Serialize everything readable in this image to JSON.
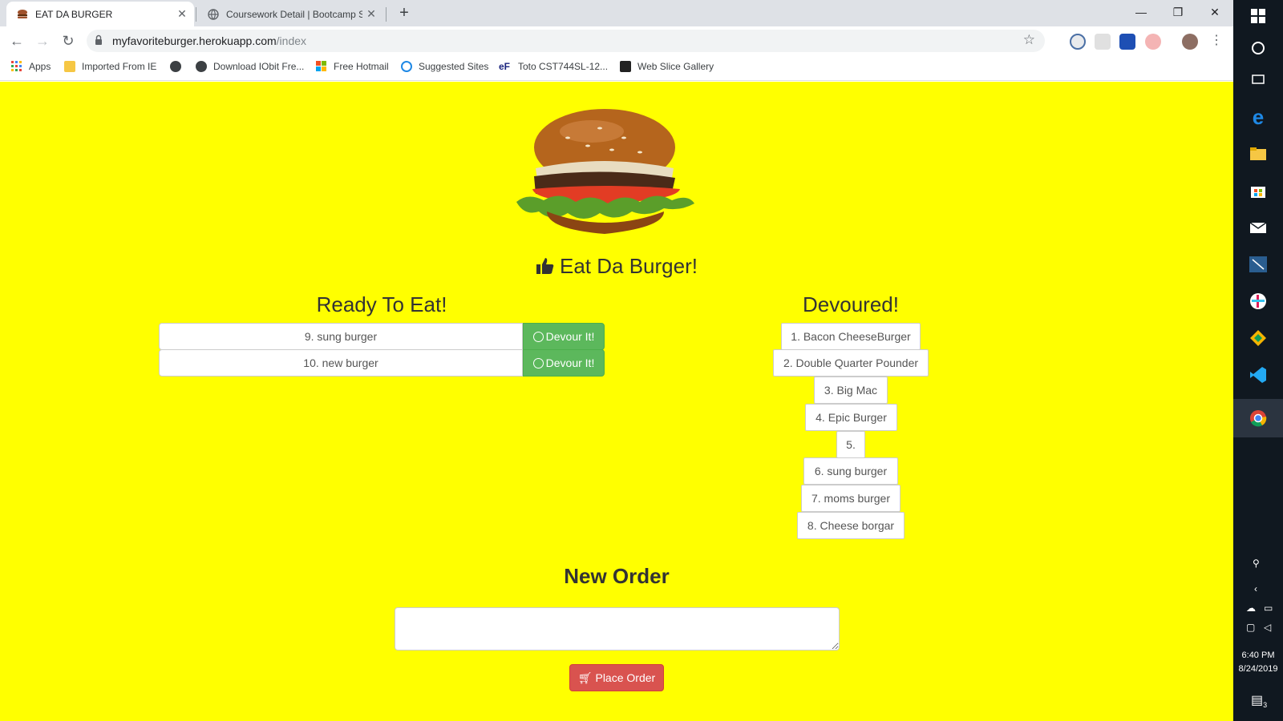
{
  "browser": {
    "tabs": [
      {
        "title": "EAT DA BURGER",
        "active": true
      },
      {
        "title": "Coursework Detail | Bootcamp Sp",
        "active": false
      }
    ],
    "new_tab_label": "+",
    "window_controls": {
      "minimize": "—",
      "restore": "❐",
      "close": "✕"
    },
    "url_host": "myfavoriteburger.herokuapp.com",
    "url_path": "/index",
    "bookmarks": [
      {
        "label": "Apps"
      },
      {
        "label": "Imported From IE"
      },
      {
        "label": ""
      },
      {
        "label": "Download IObit Fre..."
      },
      {
        "label": "Free Hotmail"
      },
      {
        "label": "Suggested Sites"
      },
      {
        "label": "Toto CST744SL-12..."
      },
      {
        "label": "Web Slice Gallery"
      }
    ]
  },
  "page": {
    "title": "Eat Da Burger!",
    "ready": {
      "heading": "Ready To Eat!",
      "items": [
        {
          "name": "9. sung burger",
          "button": "Devour It!"
        },
        {
          "name": "10. new burger",
          "button": "Devour It!"
        }
      ]
    },
    "devoured": {
      "heading": "Devoured!",
      "items": [
        "1. Bacon CheeseBurger",
        "2. Double Quarter Pounder",
        "3. Big Mac",
        "4. Epic Burger",
        "5.",
        "6. sung burger",
        "7. moms burger",
        "8. Cheese borgar"
      ]
    },
    "new_order": {
      "heading": "New Order",
      "input_value": "",
      "button": "Place Order"
    },
    "colors": {
      "background": "#ffff00",
      "devour_button": "#5cb85c",
      "place_order_button": "#d9534f"
    }
  },
  "taskbar": {
    "time": "6:40 PM",
    "date": "8/24/2019",
    "notification_count": "3"
  }
}
